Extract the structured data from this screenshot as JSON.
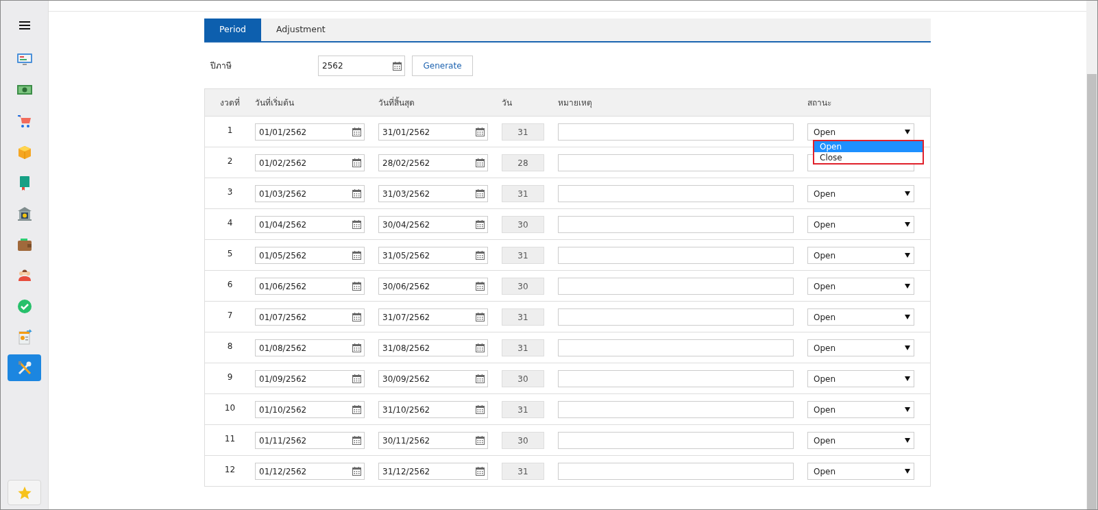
{
  "sidebar": {
    "items": [
      {
        "kind": "monitor",
        "selected": false
      },
      {
        "kind": "money",
        "selected": false
      },
      {
        "kind": "cart",
        "selected": false
      },
      {
        "kind": "box",
        "selected": false
      },
      {
        "kind": "book",
        "selected": false
      },
      {
        "kind": "bank",
        "selected": false
      },
      {
        "kind": "wallet",
        "selected": false
      },
      {
        "kind": "people",
        "selected": false
      },
      {
        "kind": "check",
        "selected": false
      },
      {
        "kind": "invoice",
        "selected": false
      },
      {
        "kind": "tools",
        "selected": true
      }
    ]
  },
  "tabs": [
    {
      "label": "Period",
      "selected": true
    },
    {
      "label": "Adjustment",
      "selected": false
    }
  ],
  "fiscal_year": {
    "label": "ปีภาษี",
    "value": "2562"
  },
  "generate_button": "Generate",
  "table": {
    "columns": [
      "งวดที่",
      "วันที่เริ่มต้น",
      "วันที่สิ้นสุด",
      "วัน",
      "หมายเหตุ",
      "สถานะ"
    ],
    "rows": [
      {
        "period": "1",
        "start": "01/01/2562",
        "end": "31/01/2562",
        "days": "31",
        "status": "Open"
      },
      {
        "period": "2",
        "start": "01/02/2562",
        "end": "28/02/2562",
        "days": "28"
      },
      {
        "period": "3",
        "start": "01/03/2562",
        "end": "31/03/2562",
        "days": "31",
        "status": "Open"
      },
      {
        "period": "4",
        "start": "01/04/2562",
        "end": "30/04/2562",
        "days": "30",
        "status": "Open"
      },
      {
        "period": "5",
        "start": "01/05/2562",
        "end": "31/05/2562",
        "days": "31",
        "status": "Open"
      },
      {
        "period": "6",
        "start": "01/06/2562",
        "end": "30/06/2562",
        "days": "30",
        "status": "Open"
      },
      {
        "period": "7",
        "start": "01/07/2562",
        "end": "31/07/2562",
        "days": "31",
        "status": "Open"
      },
      {
        "period": "8",
        "start": "01/08/2562",
        "end": "31/08/2562",
        "days": "31",
        "status": "Open"
      },
      {
        "period": "9",
        "start": "01/09/2562",
        "end": "30/09/2562",
        "days": "30",
        "status": "Open"
      },
      {
        "period": "10",
        "start": "01/10/2562",
        "end": "31/10/2562",
        "days": "31",
        "status": "Open"
      },
      {
        "period": "11",
        "start": "01/11/2562",
        "end": "30/11/2562",
        "days": "30",
        "status": "Open"
      },
      {
        "period": "12",
        "start": "01/12/2562",
        "end": "31/12/2562",
        "days": "31",
        "status": "Open"
      }
    ]
  },
  "status_dropdown": {
    "options": [
      {
        "label": "Open",
        "selected": true
      },
      {
        "label": "Close",
        "selected": false
      }
    ]
  }
}
